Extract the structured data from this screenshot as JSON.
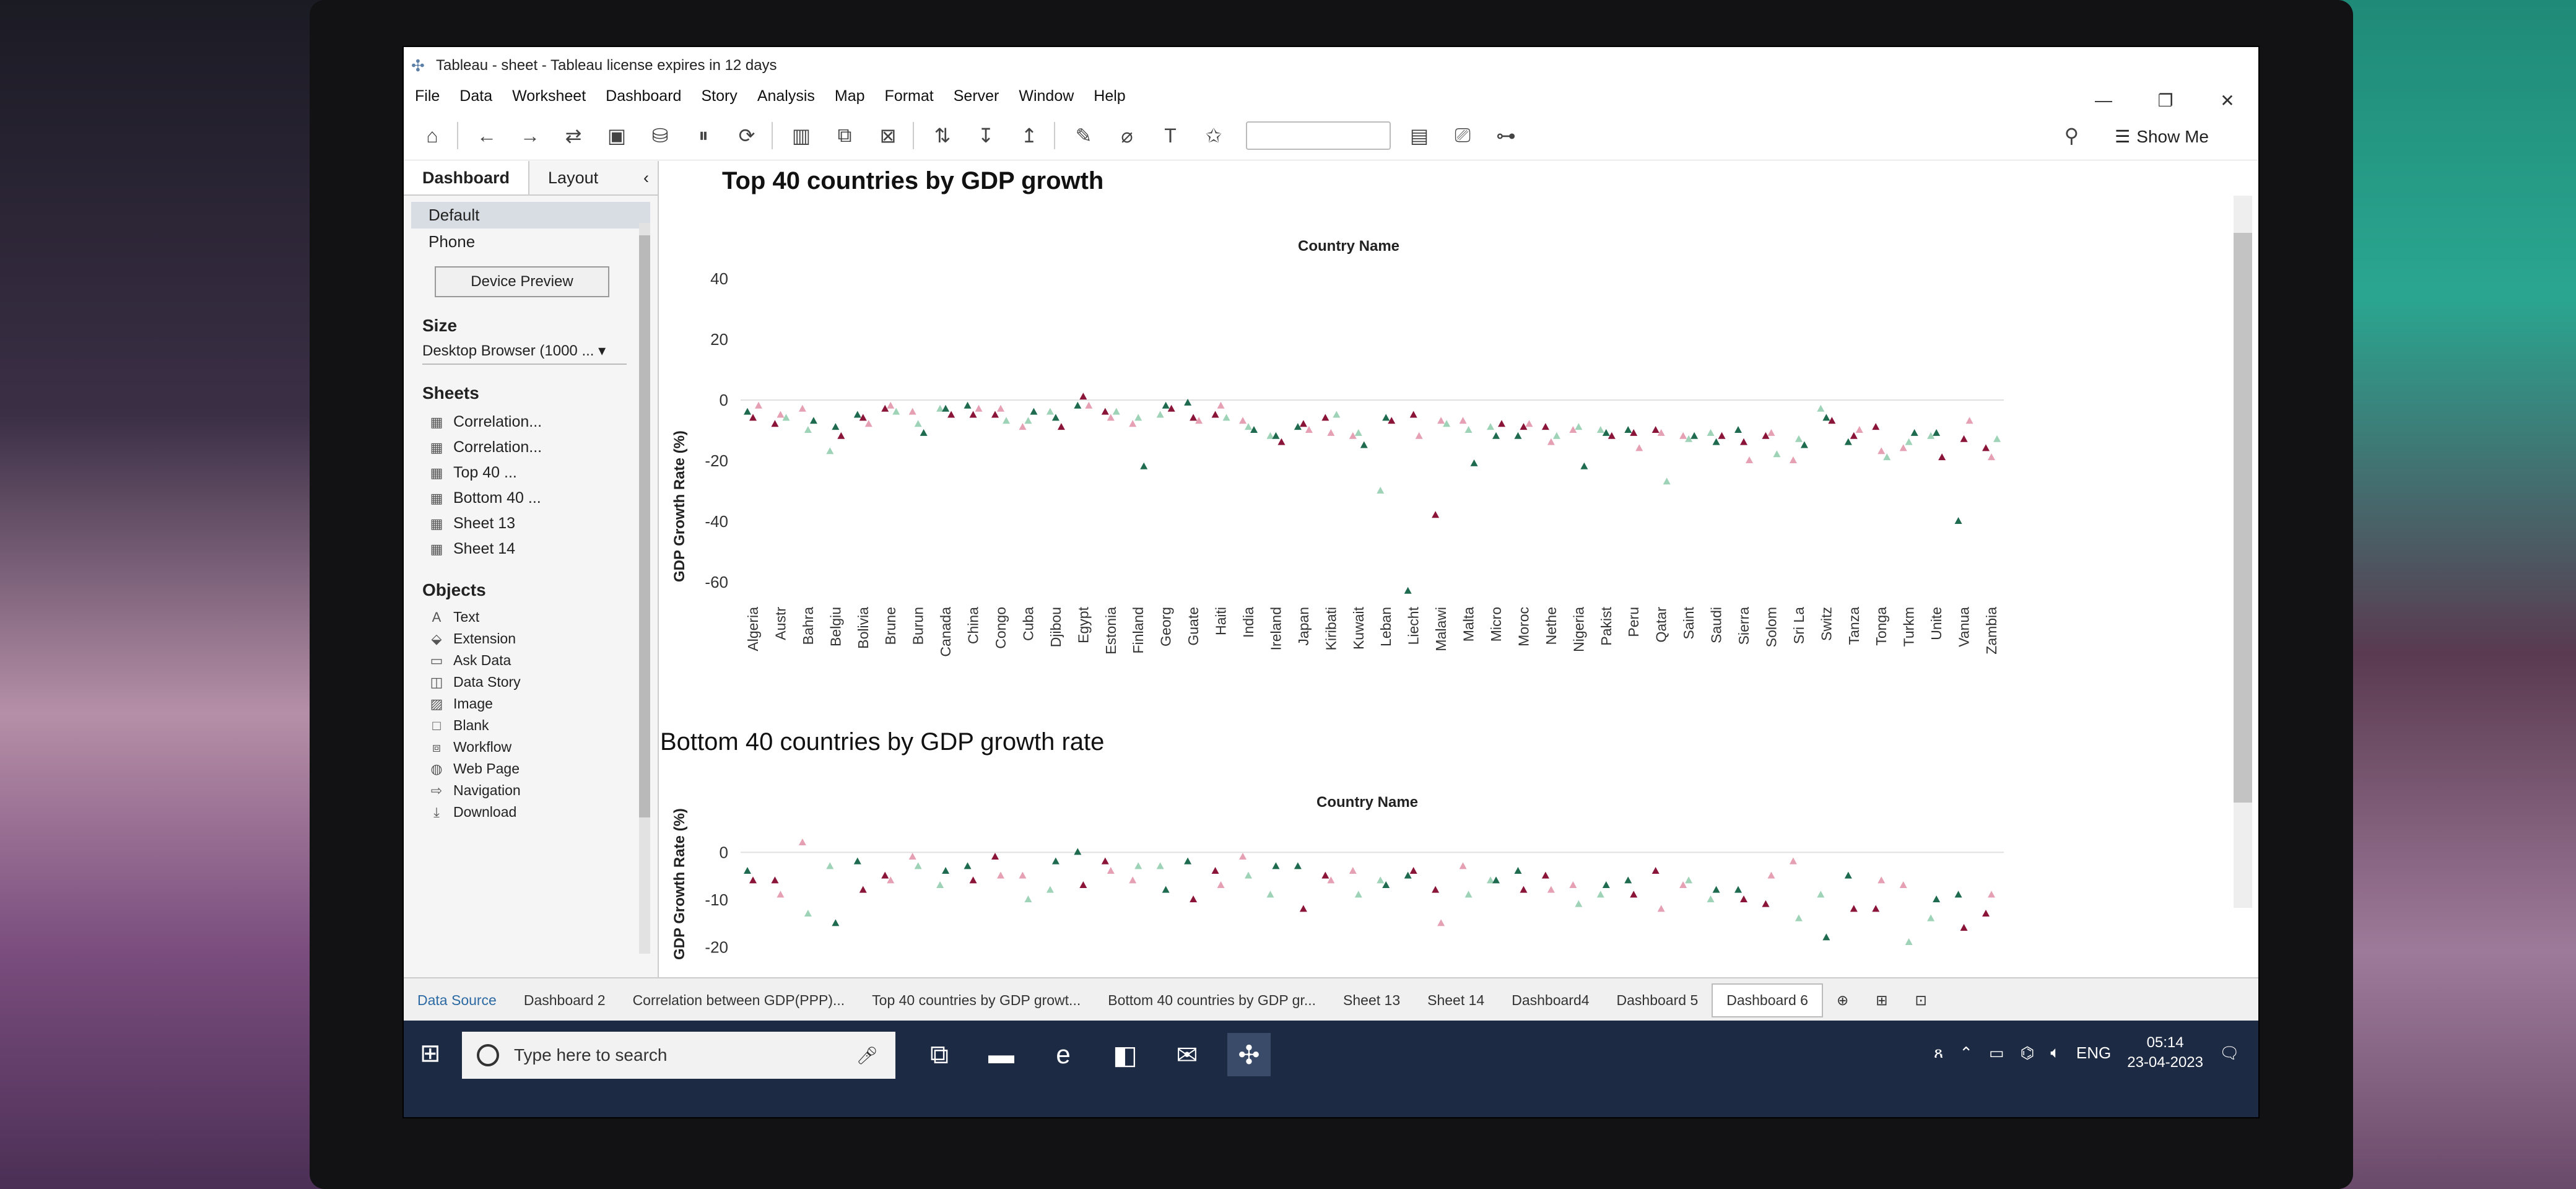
{
  "window": {
    "title": "Tableau - sheet - Tableau license expires in 12 days"
  },
  "menu": [
    "File",
    "Data",
    "Worksheet",
    "Dashboard",
    "Story",
    "Analysis",
    "Map",
    "Format",
    "Server",
    "Window",
    "Help"
  ],
  "toolbar": {
    "show_me": "Show Me"
  },
  "left_pane": {
    "tabs": [
      "Dashboard",
      "Layout"
    ],
    "devices": [
      "Default",
      "Phone"
    ],
    "device_preview": "Device Preview",
    "size_heading": "Size",
    "size_value": "Desktop Browser (1000 ...",
    "sheets_heading": "Sheets",
    "sheets": [
      "Correlation...",
      "Correlation...",
      "Top 40 ...",
      "Bottom 40 ...",
      "Sheet 13",
      "Sheet 14"
    ],
    "objects_heading": "Objects",
    "objects": [
      "Text",
      "Extension",
      "Ask Data",
      "Data Story",
      "Image",
      "Blank",
      "Workflow",
      "Web Page",
      "Navigation",
      "Download"
    ]
  },
  "sheet_tabs": [
    "Data Source",
    "Dashboard 2",
    "Correlation between GDP(PPP)...",
    "Top 40 countries by GDP growt...",
    "Bottom 40 countries by GDP gr...",
    "Sheet 13",
    "Sheet 14",
    "Dashboard4",
    "Dashboard 5",
    "Dashboard 6"
  ],
  "taskbar": {
    "search_placeholder": "Type here to search",
    "lang": "ENG",
    "time": "05:14",
    "date": "23-04-2023"
  },
  "colors": {
    "green": "#1f6b4f",
    "crimson": "#8a1538",
    "pink": "#e6a0b4",
    "lightgreen": "#9fd3b8"
  },
  "chart_data": [
    {
      "type": "scatter",
      "title": "Top 40 countries by GDP growth",
      "column_header": "Country Name",
      "ylabel": "GDP Growth Rate (%)",
      "ylim": [
        -60,
        40
      ],
      "yticks": [
        40,
        20,
        0,
        -20,
        -40,
        -60
      ],
      "categories": [
        "Algeria",
        "Austr",
        "Bahra",
        "Belgiu",
        "Bolivia",
        "Brune",
        "Burun",
        "Canada",
        "China",
        "Congo",
        "Cuba",
        "Djibou",
        "Egypt",
        "Estonia",
        "Finland",
        "Georg",
        "Guate",
        "Haiti",
        "India",
        "Ireland",
        "Japan",
        "Kiribati",
        "Kuwait",
        "Leban",
        "Liecht",
        "Malawi",
        "Malta",
        "Micro",
        "Moroc",
        "Nethe",
        "Nigeria",
        "Pakist",
        "Peru",
        "Qatar",
        "Saint",
        "Saudi",
        "Sierra",
        "Solom",
        "Sri La",
        "Switz",
        "Tanza",
        "Tonga",
        "Turkm",
        "Unite",
        "Vanua",
        "Zambia"
      ],
      "series": [
        {
          "values": [
            -4,
            -8,
            -3,
            -17,
            -5,
            -3,
            -4,
            -3,
            -2,
            -5,
            -9,
            -4,
            -2,
            -4,
            -8,
            -5,
            -1,
            -5,
            -7,
            -12,
            -9,
            -6,
            -12,
            -30,
            -63,
            -38,
            -7,
            -9,
            -12,
            -9,
            -10,
            -10,
            -10,
            -10,
            -12,
            -11,
            -10,
            -12,
            -20,
            -3,
            -14,
            -9,
            -16,
            -12,
            -40,
            -16
          ]
        },
        {
          "values": [
            -6,
            -5,
            -10,
            -9,
            -6,
            -2,
            -8,
            -3,
            -5,
            -3,
            -7,
            -6,
            1,
            -6,
            -6,
            -2,
            -6,
            -2,
            -9,
            -12,
            -8,
            -11,
            -11,
            -6,
            -5,
            -7,
            -10,
            -12,
            -9,
            -14,
            -9,
            -11,
            -11,
            -11,
            -13,
            -14,
            -14,
            -11,
            -13,
            -6,
            -12,
            -17,
            -14,
            -11,
            -13,
            -19
          ]
        },
        {
          "values": [
            -2,
            -6,
            -7,
            -12,
            -8,
            -4,
            -11,
            -5,
            -3,
            -7,
            -4,
            -9,
            -2,
            -4,
            -22,
            -3,
            -7,
            -6,
            -10,
            -14,
            -10,
            -5,
            -15,
            -7,
            -12,
            -8,
            -21,
            -8,
            -8,
            -12,
            -22,
            -12,
            -16,
            -27,
            -12,
            -12,
            -20,
            -18,
            -15,
            -7,
            -10,
            -19,
            -11,
            -19,
            -7,
            -13
          ]
        }
      ]
    },
    {
      "type": "scatter",
      "title": "Bottom 40 countries by GDP growth rate",
      "column_header": "Country Name",
      "ylabel": "GDP Growth Rate (%)",
      "ylim": [
        -25,
        5
      ],
      "yticks": [
        0,
        -10,
        -20
      ],
      "series": [
        {
          "values": [
            -4,
            -6,
            2,
            -3,
            -2,
            -5,
            -1,
            -7,
            -3,
            -1,
            -5,
            -8,
            0,
            -2,
            -6,
            -3,
            -2,
            -4,
            -1,
            -9,
            -3,
            -5,
            -4,
            -6,
            -5,
            -8,
            -3,
            -6,
            -4,
            -5,
            -7,
            -9,
            -6,
            -4,
            -7,
            -10,
            -8,
            -11,
            -2,
            -9,
            -5,
            -12,
            -7,
            -14,
            -9,
            -13
          ]
        },
        {
          "values": [
            -6,
            -9,
            -13,
            -15,
            -8,
            -6,
            -3,
            -4,
            -6,
            -5,
            -10,
            -2,
            -7,
            -4,
            -3,
            -8,
            -10,
            -7,
            -5,
            -3,
            -12,
            -6,
            -9,
            -7,
            -4,
            -15,
            -9,
            -6,
            -8,
            -8,
            -11,
            -7,
            -9,
            -12,
            -6,
            -8,
            -10,
            -5,
            -14,
            -18,
            -12,
            -6,
            -19,
            -10,
            -16,
            -9
          ]
        }
      ]
    }
  ]
}
